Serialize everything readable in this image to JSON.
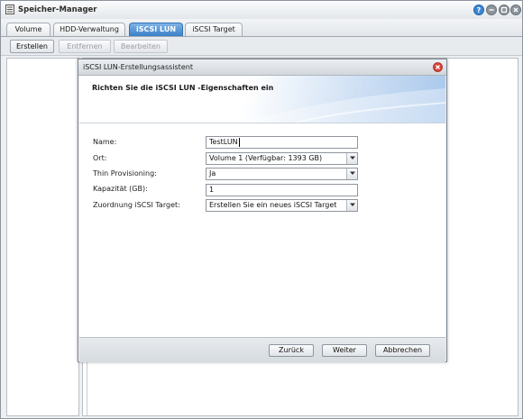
{
  "app": {
    "title": "Speicher-Manager"
  },
  "tabs": [
    {
      "label": "Volume",
      "active": false
    },
    {
      "label": "HDD-Verwaltung",
      "active": false
    },
    {
      "label": "iSCSI LUN",
      "active": true
    },
    {
      "label": "iSCSI Target",
      "active": false
    }
  ],
  "toolbar": {
    "create_label": "Erstellen",
    "remove_label": "Entfernen",
    "edit_label": "Bearbeiten"
  },
  "dialog": {
    "title": "iSCSI LUN-Erstellungsassistent",
    "header": "Richten Sie die iSCSI LUN -Eigenschaften ein",
    "fields": {
      "name": {
        "label": "Name:",
        "value": "TestLUN"
      },
      "location": {
        "label": "Ort:",
        "value": "Volume 1 (Verfügbar: 1393 GB)"
      },
      "thin_provisioning": {
        "label": "Thin Provisioning:",
        "value": "Ja"
      },
      "capacity": {
        "label": "Kapazität (GB):",
        "value": "1"
      },
      "target_mapping": {
        "label": "Zuordnung iSCSI Target:",
        "value": "Erstellen Sie ein neues iSCSI Target"
      }
    },
    "buttons": {
      "back": "Zurück",
      "next": "Weiter",
      "cancel": "Abbrechen"
    }
  },
  "colors": {
    "accent": "#3b7fc7",
    "close": "#d9443a",
    "help": "#3a87d6",
    "window_btn": "#8c949c"
  }
}
